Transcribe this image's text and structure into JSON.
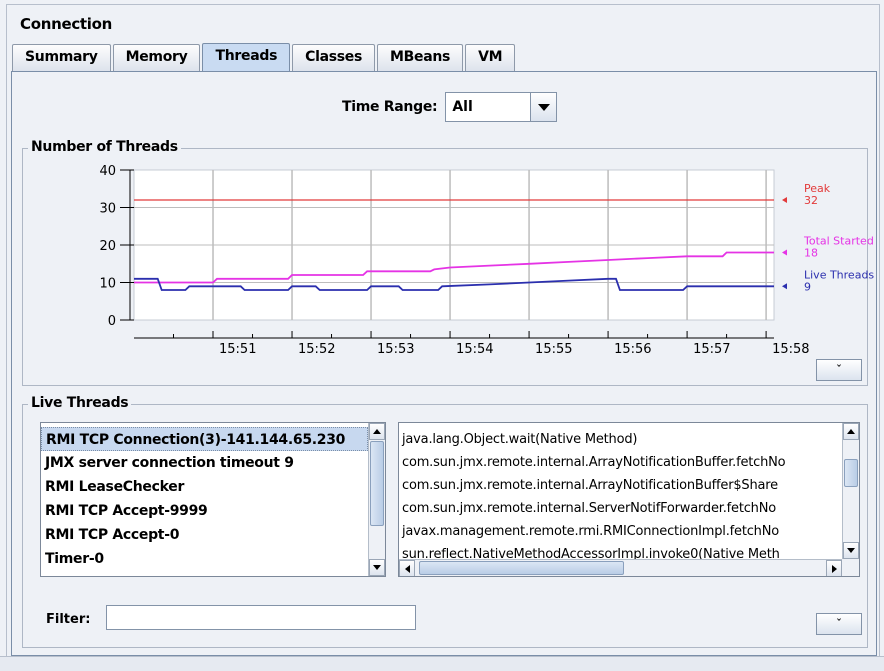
{
  "window": {
    "title": "Connection"
  },
  "tabs": [
    {
      "label": "Summary",
      "active": false
    },
    {
      "label": "Memory",
      "active": false
    },
    {
      "label": "Threads",
      "active": true
    },
    {
      "label": "Classes",
      "active": false
    },
    {
      "label": "MBeans",
      "active": false
    },
    {
      "label": "VM",
      "active": false
    }
  ],
  "time_range": {
    "label": "Time Range:",
    "value": "All"
  },
  "threads_chart": {
    "group_title": "Number of Threads",
    "collapse_label": "ˇ",
    "legend": [
      {
        "name": "Peak",
        "value": "32",
        "color": "#e23a3a"
      },
      {
        "name": "Total Started",
        "value": "18",
        "color": "#e533e5"
      },
      {
        "name": "Live Threads",
        "value": "9",
        "color": "#2b2fae"
      }
    ]
  },
  "chart_data": {
    "type": "line",
    "title": "",
    "xlabel": "",
    "ylabel": "",
    "ylim": [
      0,
      40
    ],
    "yticks": [
      "0",
      "10",
      "20",
      "30",
      "40"
    ],
    "xticks": [
      "15:51",
      "15:52",
      "15:53",
      "15:54",
      "15:55",
      "15:56",
      "15:57",
      "15:58"
    ],
    "x_range": [
      0,
      8.1
    ],
    "grid": true,
    "series": [
      {
        "name": "Peak",
        "color": "#e23a3a",
        "x": [
          0,
          8.1
        ],
        "y": [
          32,
          32
        ]
      },
      {
        "name": "Total Started",
        "color": "#e533e5",
        "x": [
          0,
          0.3,
          0.35,
          1.0,
          1.05,
          1.95,
          2.0,
          2.9,
          2.95,
          3.75,
          3.8,
          4.0,
          4.5,
          5.0,
          5.5,
          6.0,
          6.5,
          7.0,
          7.45,
          7.5,
          8.1
        ],
        "y": [
          10,
          10,
          10,
          10,
          11,
          11,
          12,
          12,
          13,
          13,
          13.5,
          14,
          14.5,
          15,
          15.5,
          16,
          16.5,
          17,
          17,
          18,
          18
        ]
      },
      {
        "name": "Live Threads",
        "color": "#2b2fae",
        "x": [
          0,
          0.2,
          0.3,
          0.35,
          0.65,
          0.7,
          1.35,
          1.4,
          1.95,
          2.0,
          2.3,
          2.35,
          2.95,
          3.0,
          3.35,
          3.4,
          3.85,
          3.9,
          4.5,
          5.0,
          5.5,
          6.0,
          6.1,
          6.15,
          6.95,
          7.0,
          7.8,
          8.1
        ],
        "y": [
          11,
          11,
          11,
          8,
          8,
          9,
          9,
          8,
          8,
          9,
          9,
          8,
          8,
          9,
          9,
          8,
          8,
          9,
          9.5,
          10,
          10.5,
          11,
          11,
          8,
          8,
          9,
          9,
          9
        ]
      }
    ]
  },
  "live_threads": {
    "group_title": "Live Threads",
    "threads": [
      "RMI TCP Connection(3)-141.144.65.230",
      "JMX server connection timeout 9",
      "RMI LeaseChecker",
      "RMI TCP Accept-9999",
      "RMI TCP Accept-0",
      "Timer-0"
    ],
    "selected_index": 0,
    "stack_trace": [
      "java.lang.Object.wait(Native Method)",
      "com.sun.jmx.remote.internal.ArrayNotificationBuffer.fetchNo",
      "com.sun.jmx.remote.internal.ArrayNotificationBuffer$Share",
      "com.sun.jmx.remote.internal.ServerNotifForwarder.fetchNo",
      "javax.management.remote.rmi.RMIConnectionImpl.fetchNo",
      "sun.reflect.NativeMethodAccessorImpl.invoke0(Native Meth"
    ],
    "filter_label": "Filter:",
    "filter_value": "",
    "collapse_label": "ˇ"
  }
}
